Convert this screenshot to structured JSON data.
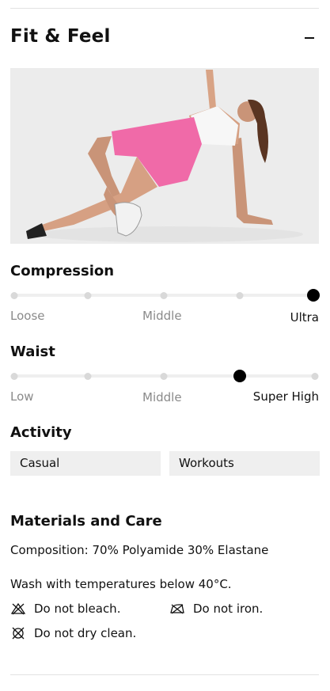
{
  "section": {
    "title": "Fit & Feel"
  },
  "hero": {
    "alt_icon": "product-photo"
  },
  "compression": {
    "title": "Compression",
    "levels": 5,
    "level": 5,
    "labels": {
      "left": "Loose",
      "middle": "Middle",
      "right": "Ultra"
    }
  },
  "waist": {
    "title": "Waist",
    "levels": 5,
    "level": 4,
    "labels": {
      "left": "Low",
      "middle": "Middle",
      "right": "Super High"
    }
  },
  "activity": {
    "title": "Activity",
    "chips": [
      "Casual",
      "Workouts"
    ]
  },
  "materials": {
    "title": "Materials and Care",
    "composition": "Composition: 70% Polyamide 30% Elastane",
    "wash": "Wash with temperatures below 40°C.",
    "care": [
      {
        "icon": "no-bleach-icon",
        "label": "Do not bleach."
      },
      {
        "icon": "no-iron-icon",
        "label": "Do not iron."
      },
      {
        "icon": "no-dry-clean-icon",
        "label": "Do not dry clean."
      }
    ]
  },
  "colors": {
    "accent": "#000000",
    "chip_bg": "#efefef",
    "track": "#efefef",
    "dot": "#d9d9d9",
    "shorts": "#f06aa8"
  }
}
